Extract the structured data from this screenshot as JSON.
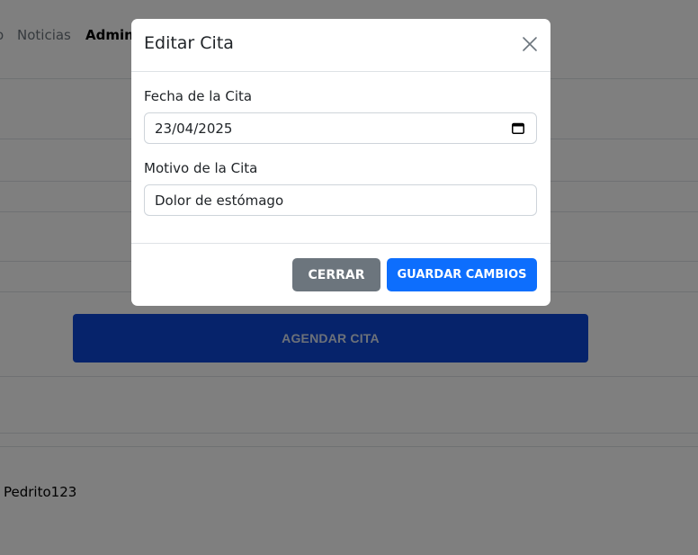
{
  "background": {
    "nav": {
      "fragment": "o",
      "news": "Noticias",
      "admin": "Admin"
    },
    "schedule_button": "AGENDAR CITA",
    "username": "Pedrito123"
  },
  "modal": {
    "title": "Editar Cita",
    "date_label": "Fecha de la Cita",
    "date_value": "23/04/2025",
    "reason_label": "Motivo de la Cita",
    "reason_value": "Dolor de estómago",
    "close_button": "CERRAR",
    "save_button": "GUARDAR CAMBIOS"
  },
  "icons": {
    "close": "close-icon",
    "calendar": "calendar-icon"
  },
  "colors": {
    "primary": "#0d6efd",
    "secondary": "#6c757d",
    "schedule_button": "#0d47d6"
  }
}
